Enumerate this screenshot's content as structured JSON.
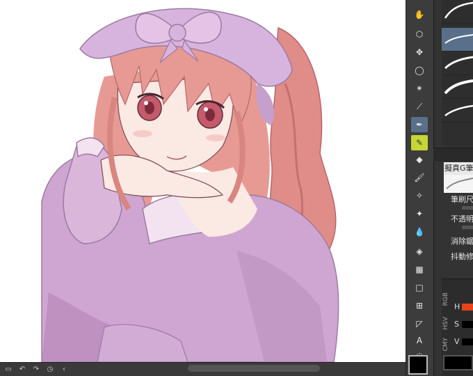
{
  "status_bar": {
    "icons": [
      "undo-icon",
      "redo-icon",
      "rotate-icon",
      "chevron-left-icon"
    ]
  },
  "tools": [
    {
      "name": "hand-tool",
      "glyph": "✋"
    },
    {
      "name": "object-tool",
      "glyph": "⬡"
    },
    {
      "name": "move-tool",
      "glyph": "✥"
    },
    {
      "name": "lasso-tool",
      "glyph": "◯"
    },
    {
      "name": "magic-wand-tool",
      "glyph": "✴"
    },
    {
      "name": "eyedropper-tool",
      "glyph": "⟋"
    },
    {
      "name": "pen-tool",
      "glyph": "✒"
    },
    {
      "name": "pencil-tool",
      "glyph": "✎"
    },
    {
      "name": "eraser-tool",
      "glyph": "◆"
    },
    {
      "name": "brush-tool",
      "glyph": "🖌"
    },
    {
      "name": "airbrush-tool",
      "glyph": "✧"
    },
    {
      "name": "decoration-tool",
      "glyph": "✦"
    },
    {
      "name": "blend-tool",
      "glyph": "💧"
    },
    {
      "name": "fill-tool",
      "glyph": "◈"
    },
    {
      "name": "gradient-tool",
      "glyph": "▦"
    },
    {
      "name": "figure-tool",
      "glyph": "□"
    },
    {
      "name": "frame-tool",
      "glyph": "⊞"
    },
    {
      "name": "ruler-tool",
      "glyph": "◸"
    },
    {
      "name": "text-tool",
      "glyph": "A"
    },
    {
      "name": "balloon-tool",
      "glyph": "◌"
    }
  ],
  "tool_properties": {
    "brush_name": "擬真G筆",
    "labels": [
      "筆刷尺",
      "不透明",
      "消除鋸",
      "抖動修"
    ]
  },
  "color_panel": {
    "tabs": [
      "RGB",
      "HSV",
      "CMY"
    ],
    "letters": [
      "H",
      "S",
      "V"
    ],
    "accent_color": "#e8431a"
  },
  "colors": {
    "canvas_bg": "#ffffff",
    "hair": "#e79a93",
    "hair_shadow": "#c96b6b",
    "clothing": "#cfa6d1",
    "clothing_shadow": "#b384b6",
    "skin": "#fbe9e3",
    "line": "#7a4b55",
    "active_tool": "#5a6f8a",
    "sub_active_tool": "#c6d636"
  }
}
